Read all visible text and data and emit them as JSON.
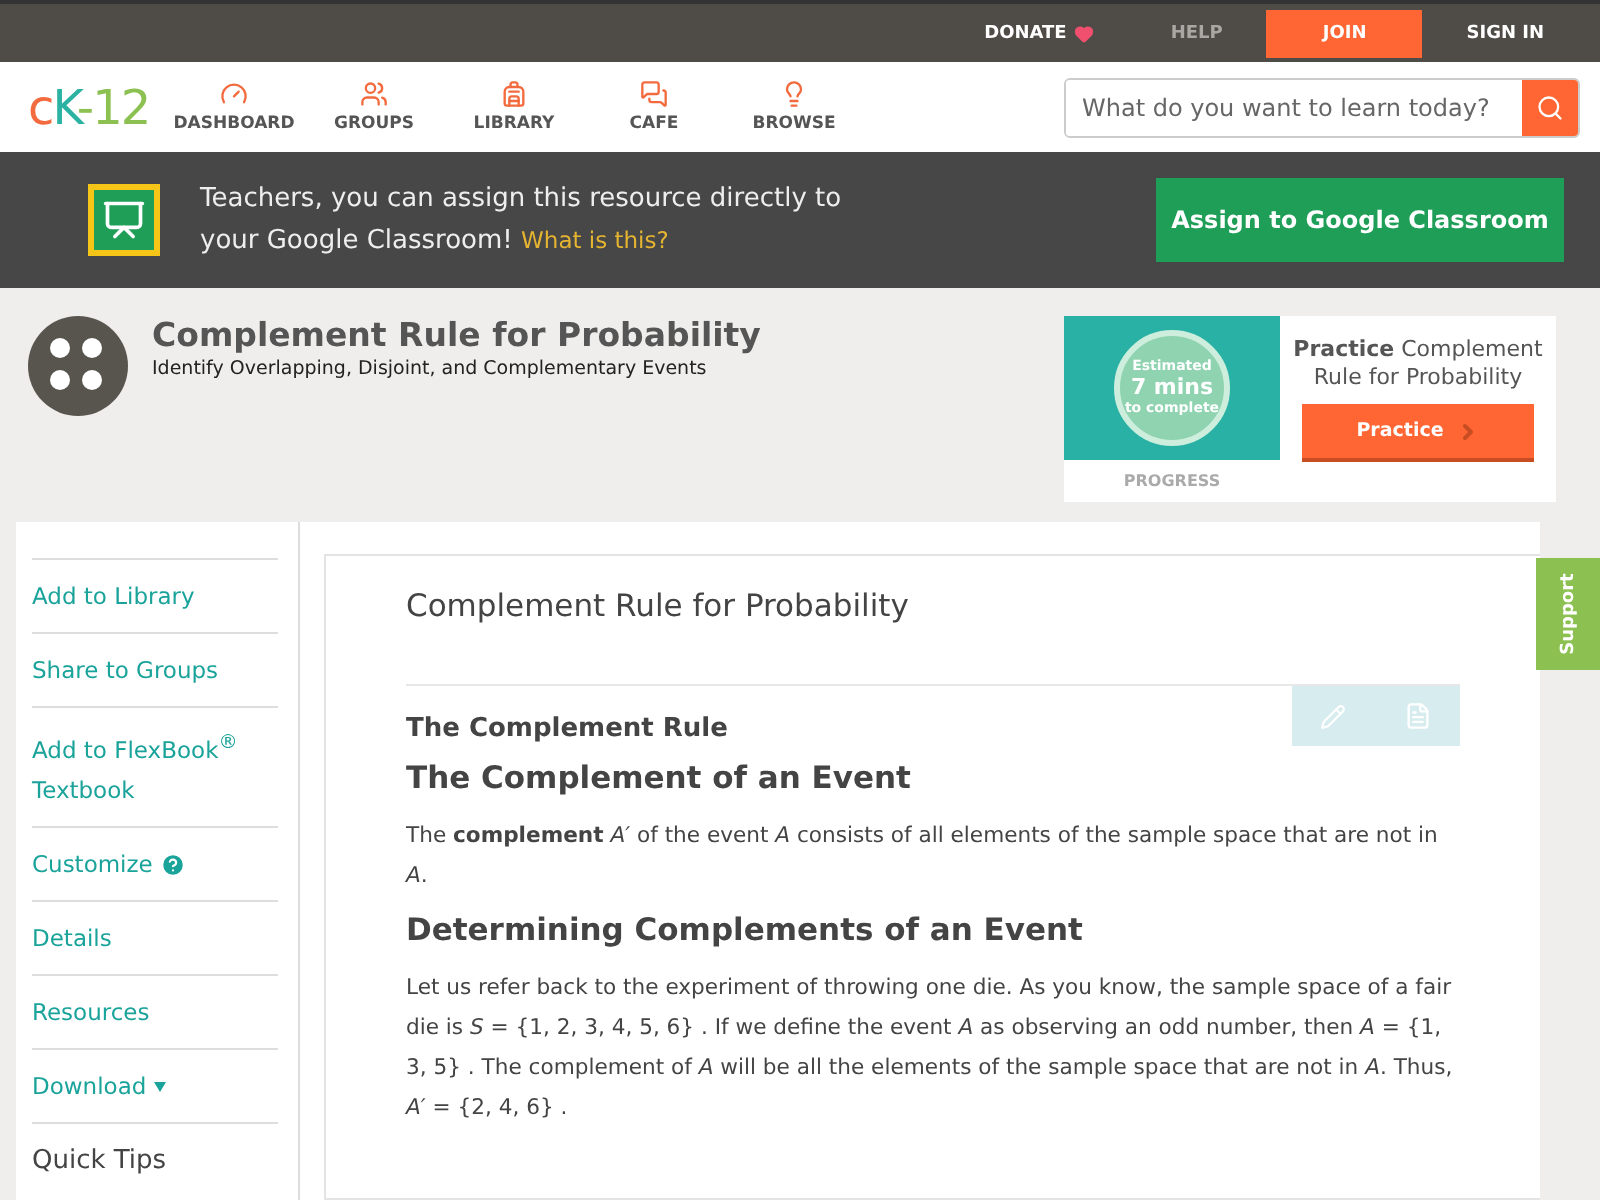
{
  "top_bar": {
    "links": [
      {
        "label": "DONATE",
        "kind": "donate"
      },
      {
        "label": "HELP",
        "kind": "muted"
      },
      {
        "label": "JOIN",
        "kind": "primary"
      },
      {
        "label": "SIGN IN",
        "kind": "plain"
      }
    ]
  },
  "nav": {
    "logo": {
      "c": "c",
      "k": "K",
      "rest": "-12"
    },
    "items": [
      {
        "label": "DASHBOARD"
      },
      {
        "label": "GROUPS"
      },
      {
        "label": "LIBRARY"
      },
      {
        "label": "CAFE"
      },
      {
        "label": "BROWSE"
      }
    ],
    "search": {
      "placeholder": "What do you want to learn today?"
    }
  },
  "classroom_banner": {
    "text": "Teachers, you can assign this resource directly to your Google Classroom!",
    "link": "What is this?",
    "button": "Assign to Google Classroom"
  },
  "concept": {
    "title": "Complement Rule for Probability",
    "subtitle": "Identify Overlapping, Disjoint, and Complementary Events"
  },
  "practice_card": {
    "estimate": [
      "Estimated",
      "7 mins",
      "to complete"
    ],
    "progress_label": "PROGRESS",
    "heading_bold": "Practice",
    "heading_rest": "Complement Rule for Probability",
    "button": "Practice"
  },
  "sidebar": {
    "items": [
      {
        "label": "Add to Library",
        "kind": "link"
      },
      {
        "label": "Share to Groups",
        "kind": "link"
      },
      {
        "label": "Add to FlexBook$^{®}$ Textbook",
        "kind": "link"
      },
      {
        "label": "Customize",
        "kind": "help"
      },
      {
        "label": "Details",
        "kind": "link"
      },
      {
        "label": "Resources",
        "kind": "link"
      },
      {
        "label": "Download",
        "kind": "dropdown"
      },
      {
        "label": "Quick Tips",
        "kind": "heading"
      }
    ]
  },
  "article": {
    "title": "Complement Rule for Probability",
    "blocks": [
      {
        "kind": "h3",
        "text": "The Complement Rule"
      },
      {
        "kind": "h2",
        "text": "The Complement of an Event"
      },
      {
        "kind": "p",
        "text": "The **complement** *A′* of the event *A* consists of all elements of the sample space that are not in *A*."
      },
      {
        "kind": "h2",
        "text": "Determining Complements of an Event"
      },
      {
        "kind": "p",
        "text": "Let us refer back to the experiment of throwing one die. As you know, the sample space of a fair die is *S* = {1, 2, 3, 4, 5, 6} . If we define the event *A* as observing an odd number, then *A* = {1, 3, 5} . The complement of *A* will be all the elements of the sample space that are not in *A*. Thus, *A′* = {2, 4, 6} ."
      }
    ]
  },
  "support_tab": "Support"
}
